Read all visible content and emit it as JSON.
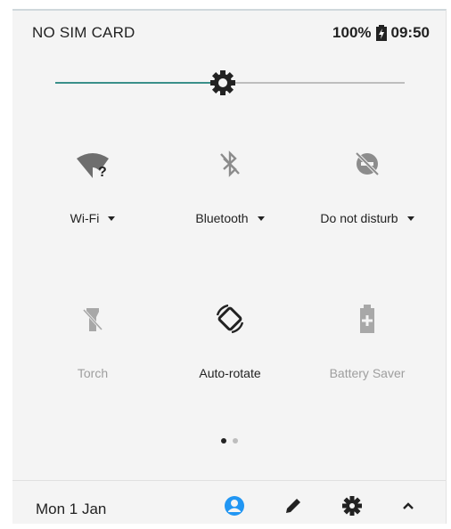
{
  "status_bar": {
    "carrier": "NO SIM CARD",
    "battery": "100%",
    "time": "09:50"
  },
  "brightness": {
    "level": 0.48,
    "accent": "#3a8f8a"
  },
  "tiles": [
    {
      "label": "Wi-Fi",
      "icon": "wifi-unknown-icon",
      "active": true,
      "dropdown": true
    },
    {
      "label": "Bluetooth",
      "icon": "bluetooth-off-icon",
      "active": true,
      "dropdown": true
    },
    {
      "label": "Do not disturb",
      "icon": "do-not-disturb-off-icon",
      "active": true,
      "dropdown": true
    },
    {
      "label": "Torch",
      "icon": "torch-off-icon",
      "active": false,
      "dropdown": false
    },
    {
      "label": "Auto-rotate",
      "icon": "auto-rotate-icon",
      "active": true,
      "dropdown": false
    },
    {
      "label": "Battery Saver",
      "icon": "battery-saver-icon",
      "active": false,
      "dropdown": false
    }
  ],
  "pager": {
    "pages": 2,
    "current": 1
  },
  "footer": {
    "date": "Mon 1 Jan",
    "user_icon": "user-icon",
    "edit_icon": "edit-icon",
    "settings_icon": "settings-icon",
    "collapse_icon": "chevron-up-icon",
    "user_color": "#2196f3"
  }
}
